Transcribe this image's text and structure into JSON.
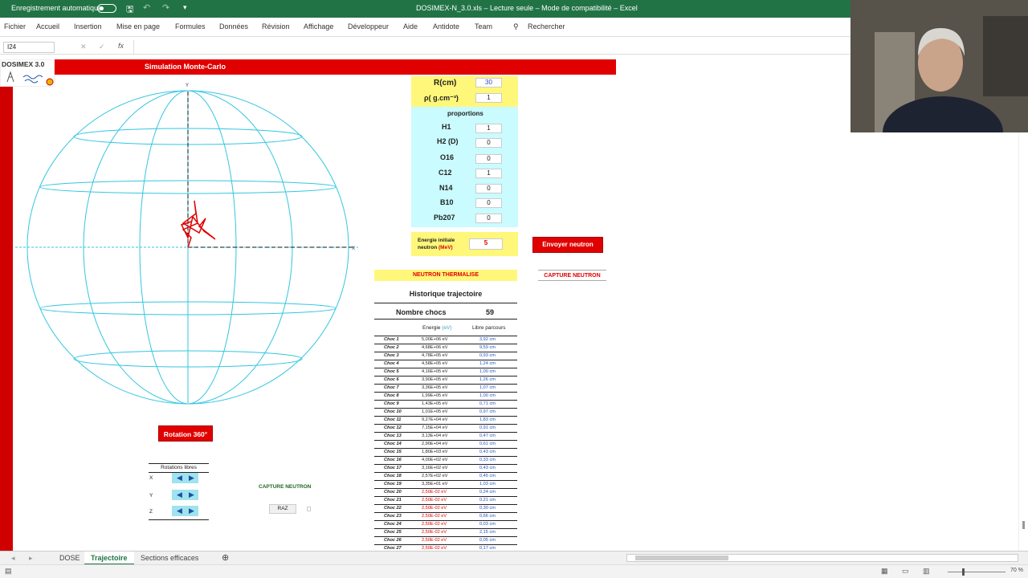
{
  "titlebar": {
    "autosave": "Enregistrement automatique",
    "filename": "DOSIMEX-N_3.0.xls",
    "readonly": "Lecture seule",
    "compat": "Mode de compatibilité",
    "app": "Excel"
  },
  "ribbon": {
    "tabs": [
      "Fichier",
      "Accueil",
      "Insertion",
      "Mise en page",
      "Formules",
      "Données",
      "Révision",
      "Affichage",
      "Développeur",
      "Aide",
      "Antidote",
      "Team"
    ],
    "search": "Rechercher"
  },
  "formula": {
    "cell": "I24",
    "fx": "fx"
  },
  "logo": "DOSIMEX 3.0",
  "header": "Simulation Monte-Carlo",
  "params": {
    "r_label": "R(cm)",
    "r_val": "30",
    "rho_label": "ρ( g.cm⁻³)",
    "rho_val": "1",
    "proportions": "proportions",
    "elements": [
      {
        "n": "H1",
        "v": "1"
      },
      {
        "n": "H2 (D)",
        "v": "0"
      },
      {
        "n": "O16",
        "v": "0"
      },
      {
        "n": "C12",
        "v": "1"
      },
      {
        "n": "N14",
        "v": "0"
      },
      {
        "n": "B10",
        "v": "0"
      },
      {
        "n": "Pb207",
        "v": "0"
      }
    ],
    "energy_label1": "Energie initiale",
    "energy_label2": "neutron",
    "energy_unit": "(MeV)",
    "energy_val": "5"
  },
  "buttons": {
    "send": "Envoyer neutron",
    "capture": "CAPTURE NEUTRON",
    "rotation": "Rotation 360°",
    "raz": "RAZ"
  },
  "status_msg": "NEUTRON THERMALISE",
  "history": {
    "title": "Historique trajectoire",
    "count_label": "Nombre chocs",
    "count": "59",
    "col_energy": "Energie",
    "col_energy_unit": "(eV)",
    "col_path": "Libre parcours",
    "rows": [
      {
        "c": "Choc 1",
        "e": "5,00E+06 eV",
        "p": "3,92 cm"
      },
      {
        "c": "Choc 2",
        "e": "4,68E+06 eV",
        "p": "9,59 cm"
      },
      {
        "c": "Choc 3",
        "e": "4,78E+05 eV",
        "p": "0,93 cm"
      },
      {
        "c": "Choc 4",
        "e": "4,58E+05 eV",
        "p": "1,24 cm"
      },
      {
        "c": "Choc 5",
        "e": "4,16E+05 eV",
        "p": "1,00 cm"
      },
      {
        "c": "Choc 6",
        "e": "3,90E+05 eV",
        "p": "1,26 cm"
      },
      {
        "c": "Choc 7",
        "e": "3,36E+05 eV",
        "p": "1,07 cm"
      },
      {
        "c": "Choc 8",
        "e": "1,99E+05 eV",
        "p": "1,00 cm"
      },
      {
        "c": "Choc 9",
        "e": "1,43E+05 eV",
        "p": "0,71 cm"
      },
      {
        "c": "Choc 10",
        "e": "1,01E+05 eV",
        "p": "0,97 cm"
      },
      {
        "c": "Choc 11",
        "e": "9,27E+04 eV",
        "p": "1,83 cm"
      },
      {
        "c": "Choc 12",
        "e": "7,15E+04 eV",
        "p": "0,91 cm"
      },
      {
        "c": "Choc 13",
        "e": "3,13E+04 eV",
        "p": "0,47 cm"
      },
      {
        "c": "Choc 14",
        "e": "2,90E+04 eV",
        "p": "0,61 cm"
      },
      {
        "c": "Choc 15",
        "e": "1,80E+03 eV",
        "p": "0,43 cm"
      },
      {
        "c": "Choc 16",
        "e": "4,00E+02 eV",
        "p": "0,33 cm"
      },
      {
        "c": "Choc 17",
        "e": "3,16E+02 eV",
        "p": "0,43 cm"
      },
      {
        "c": "Choc 18",
        "e": "2,57E+02 eV",
        "p": "0,45 cm"
      },
      {
        "c": "Choc 19",
        "e": "3,35E+01 eV",
        "p": "1,03 cm"
      },
      {
        "c": "Choc 20",
        "e": "2,50E-02 eV",
        "p": "0,24 cm",
        "t": 1
      },
      {
        "c": "Choc 21",
        "e": "2,50E-02 eV",
        "p": "0,21 cm",
        "t": 1
      },
      {
        "c": "Choc 22",
        "e": "2,50E-02 eV",
        "p": "0,30 cm",
        "t": 1
      },
      {
        "c": "Choc 23",
        "e": "2,50E-02 eV",
        "p": "0,66 cm",
        "t": 1
      },
      {
        "c": "Choc 24",
        "e": "2,50E-02 eV",
        "p": "0,03 cm",
        "t": 1
      },
      {
        "c": "Choc 25",
        "e": "2,50E-02 eV",
        "p": "2,15 cm",
        "t": 1
      },
      {
        "c": "Choc 26",
        "e": "2,50E-02 eV",
        "p": "0,05 cm",
        "t": 1
      },
      {
        "c": "Choc 27",
        "e": "2,50E-02 eV",
        "p": "0,17 cm",
        "t": 1
      }
    ]
  },
  "rotations": {
    "title": "Rotations libres",
    "axes": [
      "X",
      "Y",
      "Z"
    ]
  },
  "capture_label": "CAPTURE NEUTRON",
  "sphere_axis_y": "Y",
  "sphere_axis_x": "X",
  "sheets": {
    "tabs": [
      "DOSE",
      "Trajectoire",
      "Sections efficaces"
    ],
    "active": "Trajectoire"
  },
  "zoom": "70 %",
  "colors": {
    "excel_green": "#217346",
    "red": "#e00000",
    "yellow": "#fff77a",
    "cyan": "#c9fbff",
    "sphere": "#33c6e0"
  }
}
